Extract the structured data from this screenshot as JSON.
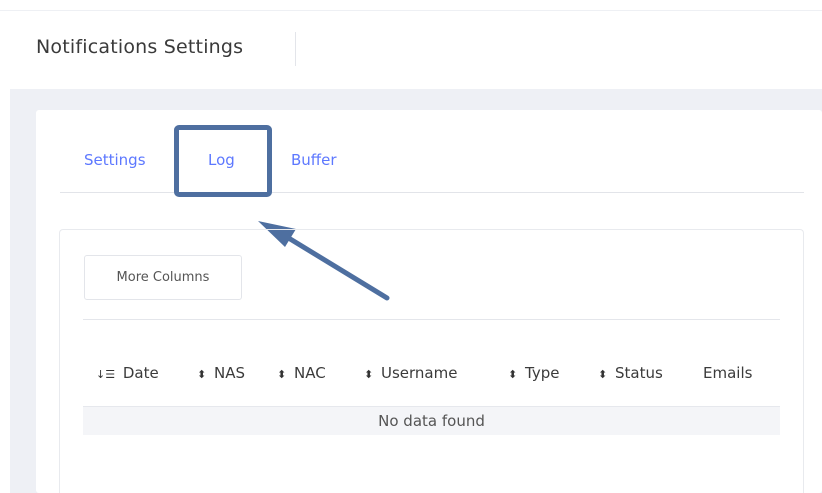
{
  "header": {
    "title": "Notifications Settings"
  },
  "tabs": [
    {
      "label": "Settings"
    },
    {
      "label": "Log",
      "highlighted": true
    },
    {
      "label": "Buffer"
    }
  ],
  "toolbar": {
    "more_columns_label": "More Columns"
  },
  "table": {
    "columns": [
      {
        "label": "Date",
        "sort_icon": "sort-desc-icon"
      },
      {
        "label": "NAS",
        "sort_icon": "sort-icon"
      },
      {
        "label": "NAC",
        "sort_icon": "sort-icon"
      },
      {
        "label": "Username",
        "sort_icon": "sort-icon"
      },
      {
        "label": "Type",
        "sort_icon": "sort-icon"
      },
      {
        "label": "Status",
        "sort_icon": "sort-icon"
      },
      {
        "label": "Emails"
      }
    ],
    "empty_message": "No data found"
  },
  "colors": {
    "accent": "#5d78ff",
    "annotation": "#4e6fa0",
    "background": "#eef0f5"
  }
}
